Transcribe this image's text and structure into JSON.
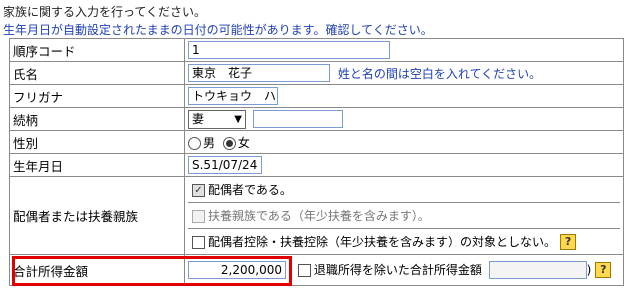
{
  "intro_text": "家族に関する入力を行ってください。",
  "warning_text": "生年月日が自動設定されたままの日付の可能性があります。確認してください。",
  "rows": {
    "order_code": {
      "label": "順序コード",
      "value": "1"
    },
    "name": {
      "label": "氏名",
      "value": "東京　花子",
      "hint": "姓と名の間は空白を入れてください。"
    },
    "furigana": {
      "label": "フリガナ",
      "value": "トウキョウ　ハナコ"
    },
    "relation": {
      "label": "続柄",
      "selected": "妻",
      "extra_value": ""
    },
    "gender": {
      "label": "性別",
      "options": [
        "男",
        "女"
      ],
      "selected": "女"
    },
    "birthdate": {
      "label": "生年月日",
      "value": "S.51/07/24"
    },
    "spouse": {
      "label": "配偶者または扶養親族",
      "option1": "配偶者である。",
      "option1_checked": true,
      "option2": "扶養親族である（年少扶養を含みます）。",
      "option2_checked": false,
      "option2_disabled": true,
      "option3": "配偶者控除・扶養控除（年少扶養を含みます）の対象としない。",
      "option3_checked": false
    },
    "income": {
      "label": "合計所得金額",
      "value": "2,200,000",
      "exclude_label": "退職所得を除いた合計所得金額",
      "exclude_checked": false,
      "exclude_value": "",
      "close_paren": ")"
    }
  },
  "help_icon_label": "?",
  "colors": {
    "hint_blue": "#1f3fb8",
    "highlight_red": "#e00000",
    "help_yellow": "#ffd84d"
  }
}
